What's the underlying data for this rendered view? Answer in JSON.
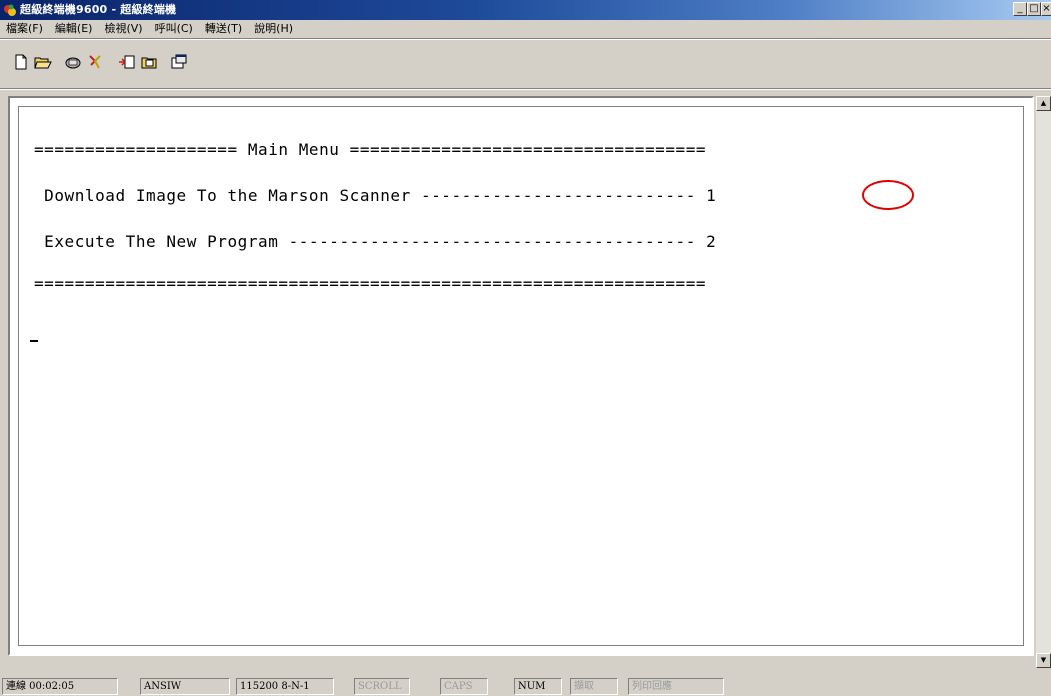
{
  "window": {
    "title": "超級終端機9600 - 超級終端機",
    "min_label": "_",
    "max_label": "□",
    "close_label": "×"
  },
  "menu": [
    {
      "label": "檔案(F)"
    },
    {
      "label": "編輯(E)"
    },
    {
      "label": "檢視(V)"
    },
    {
      "label": "呼叫(C)"
    },
    {
      "label": "轉送(T)"
    },
    {
      "label": "說明(H)"
    }
  ],
  "toolbar": [
    {
      "icon": "new-document-icon"
    },
    {
      "icon": "open-folder-icon"
    },
    {
      "icon": "connect-phone-icon"
    },
    {
      "icon": "disconnect-icon"
    },
    {
      "icon": "send-file-icon"
    },
    {
      "icon": "receive-file-icon"
    },
    {
      "icon": "properties-icon"
    }
  ],
  "terminal": {
    "lines": [
      "==================== Main Menu ===================================",
      " Download Image To the Marson Scanner --------------------------- 1",
      " Execute The New Program ---------------------------------------- 2",
      "=================================================================="
    ],
    "highlighted_option": "1",
    "highlight_color": "#e00000"
  },
  "scrollbar": {
    "up_arrow": "▲",
    "down_arrow": "▼"
  },
  "status": {
    "connected": "連線 00:02:05",
    "emulation": "ANSIW",
    "port_settings": "115200 8-N-1",
    "scroll": "SCROLL",
    "caps": "CAPS",
    "num": "NUM",
    "capture": "擷取",
    "print_echo": "列印回應"
  }
}
